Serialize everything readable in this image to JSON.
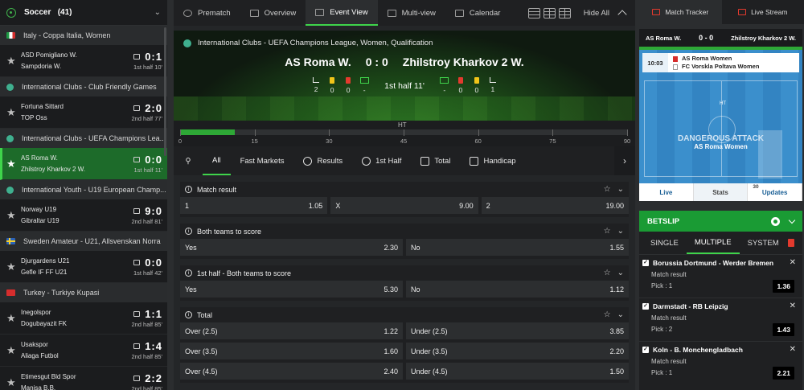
{
  "sidebar": {
    "sport": "Soccer",
    "count": "(41)",
    "leagues": [
      {
        "name": "Italy - Coppa Italia, Women",
        "flag": "it",
        "matches": [
          {
            "home": "ASD Pomigliano W.",
            "away": "Sampdoria W.",
            "score": "0:1",
            "time": "1st half  10'"
          }
        ]
      },
      {
        "name": "International Clubs - Club Friendly Games",
        "flag": "globe",
        "matches": [
          {
            "home": "Fortuna Sittard",
            "away": "TOP Oss",
            "score": "2:0",
            "time": "2nd half  77'"
          }
        ]
      },
      {
        "name": "International Clubs - UEFA Champions Lea...",
        "flag": "globe",
        "matches": [
          {
            "home": "AS Roma W.",
            "away": "Zhilstroy Kharkov 2 W.",
            "score": "0:0",
            "time": "1st half  11'"
          }
        ]
      },
      {
        "name": "International Youth - U19 European Champ...",
        "flag": "globe",
        "matches": [
          {
            "home": "Norway U19",
            "away": "Gibraltar U19",
            "score": "9:0",
            "time": "2nd half  81'"
          }
        ]
      },
      {
        "name": "Sweden Amateur - U21, Allsvenskan Norra",
        "flag": "se",
        "matches": [
          {
            "home": "Djurgardens U21",
            "away": "Gefle IF FF U21",
            "score": "0:0",
            "time": "1st half  42'"
          }
        ]
      },
      {
        "name": "Turkey - Turkiye Kupasi",
        "flag": "tr",
        "matches": [
          {
            "home": "Inegolspor",
            "away": "Dogubayazit FK",
            "score": "1:1",
            "time": "2nd half  85'"
          },
          {
            "home": "Usakspor",
            "away": "Aliaga Futbol",
            "score": "1:4",
            "time": "2nd half  85'"
          },
          {
            "home": "Etimesgut Bld Spor",
            "away": "Manisa B.B.",
            "score": "2:2",
            "time": "2nd half  85'"
          }
        ]
      }
    ]
  },
  "topnav": {
    "tabs": [
      "Prematch",
      "Overview",
      "Event View",
      "Multi-view",
      "Calendar"
    ],
    "active": "Event View",
    "hide_all": "Hide All"
  },
  "scoreboard": {
    "competition": "International Clubs - UEFA Champions League, Women, Qualification",
    "home": "AS Roma W.",
    "away": "Zhilstroy Kharkov 2 W.",
    "score": "0 : 0",
    "half": "1st half  11'",
    "home_stats": [
      "2",
      "0",
      "0",
      "-"
    ],
    "away_stats": [
      "-",
      "0",
      "0",
      "1"
    ]
  },
  "timeline": {
    "ht": "HT",
    "ticks": [
      "0",
      "15",
      "30",
      "45",
      "60",
      "75",
      "90"
    ],
    "progress_minutes": 11
  },
  "market_tabs": [
    "All",
    "Fast Markets",
    "Results",
    "1st Half",
    "Total",
    "Handicap"
  ],
  "markets": [
    {
      "title": "Match result",
      "rows": [
        [
          [
            "1",
            "1.05"
          ],
          [
            "X",
            "9.00"
          ],
          [
            "2",
            "19.00"
          ]
        ]
      ]
    },
    {
      "title": "Both teams to score",
      "rows": [
        [
          [
            "Yes",
            "2.30"
          ],
          [
            "No",
            "1.55"
          ]
        ]
      ]
    },
    {
      "title": "1st half - Both teams to score",
      "rows": [
        [
          [
            "Yes",
            "5.30"
          ],
          [
            "No",
            "1.12"
          ]
        ]
      ]
    },
    {
      "title": "Total",
      "rows": [
        [
          [
            "Over (2.5)",
            "1.22"
          ],
          [
            "Under (2.5)",
            "3.85"
          ]
        ],
        [
          [
            "Over (3.5)",
            "1.60"
          ],
          [
            "Under (3.5)",
            "2.20"
          ]
        ],
        [
          [
            "Over (4.5)",
            "2.40"
          ],
          [
            "Under (4.5)",
            "1.50"
          ]
        ]
      ]
    }
  ],
  "tracker": {
    "tabs": [
      "Match Tracker",
      "Live Stream"
    ],
    "home": "AS Roma W.",
    "score": "0 - 0",
    "away": "Zhilstroy Kharkov 2 W.",
    "clock": "10:03",
    "panel_home": "AS Roma Women",
    "panel_away": "FC Vorskla Poltava Women",
    "ht": "HT",
    "event": "DANGEROUS ATTACK",
    "event_team": "AS Roma Women",
    "bottom": [
      "Live",
      "Stats",
      "Updates"
    ],
    "updates_count": "30"
  },
  "betslip": {
    "title": "BETSLIP",
    "tabs": [
      "SINGLE",
      "MULTIPLE",
      "SYSTEM"
    ],
    "active_tab": "MULTIPLE",
    "bets": [
      {
        "match": "Borussia Dortmund - Werder Bremen",
        "market": "Match result",
        "pick": "Pick :  1",
        "odd": "1.36"
      },
      {
        "match": "Darmstadt - RB Leipzig",
        "market": "Match result",
        "pick": "Pick :  2",
        "odd": "1.43"
      },
      {
        "match": "Koln - B. Monchengladbach",
        "market": "Match result",
        "pick": "Pick :  1",
        "odd": "2.21"
      }
    ]
  }
}
